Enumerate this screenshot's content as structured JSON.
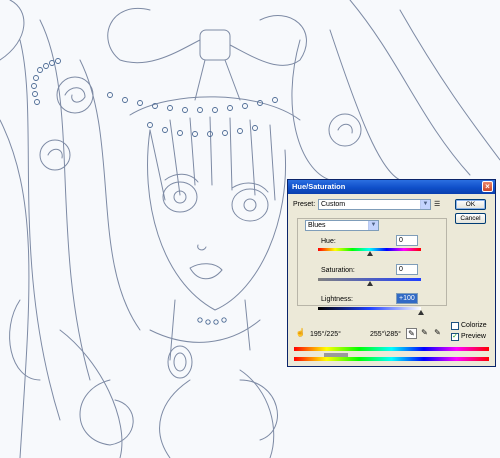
{
  "dialog": {
    "title": "Hue/Saturation",
    "close_icon": "close-icon",
    "preset_label": "Preset:",
    "preset_value": "Custom",
    "preset_menu_icon": "preset-options-icon",
    "ok_label": "OK",
    "cancel_label": "Cancel",
    "edit_value": "Blues",
    "hue": {
      "label": "Hue:",
      "value": "0",
      "level": 0.5
    },
    "saturation": {
      "label": "Saturation:",
      "value": "0",
      "level": 0.5
    },
    "lightness": {
      "label": "Lightness:",
      "value": "+100",
      "level": 1.0
    },
    "range_left": "195°/225°",
    "range_right": "255°\\285°",
    "colorize": {
      "label": "Colorize",
      "checked": false
    },
    "preview": {
      "label": "Preview",
      "checked": true
    },
    "accent_color": "#0a246a",
    "tools": [
      "hand-icon",
      "eyedropper-icon",
      "eyedropper-plus-icon",
      "eyedropper-minus-icon"
    ]
  }
}
